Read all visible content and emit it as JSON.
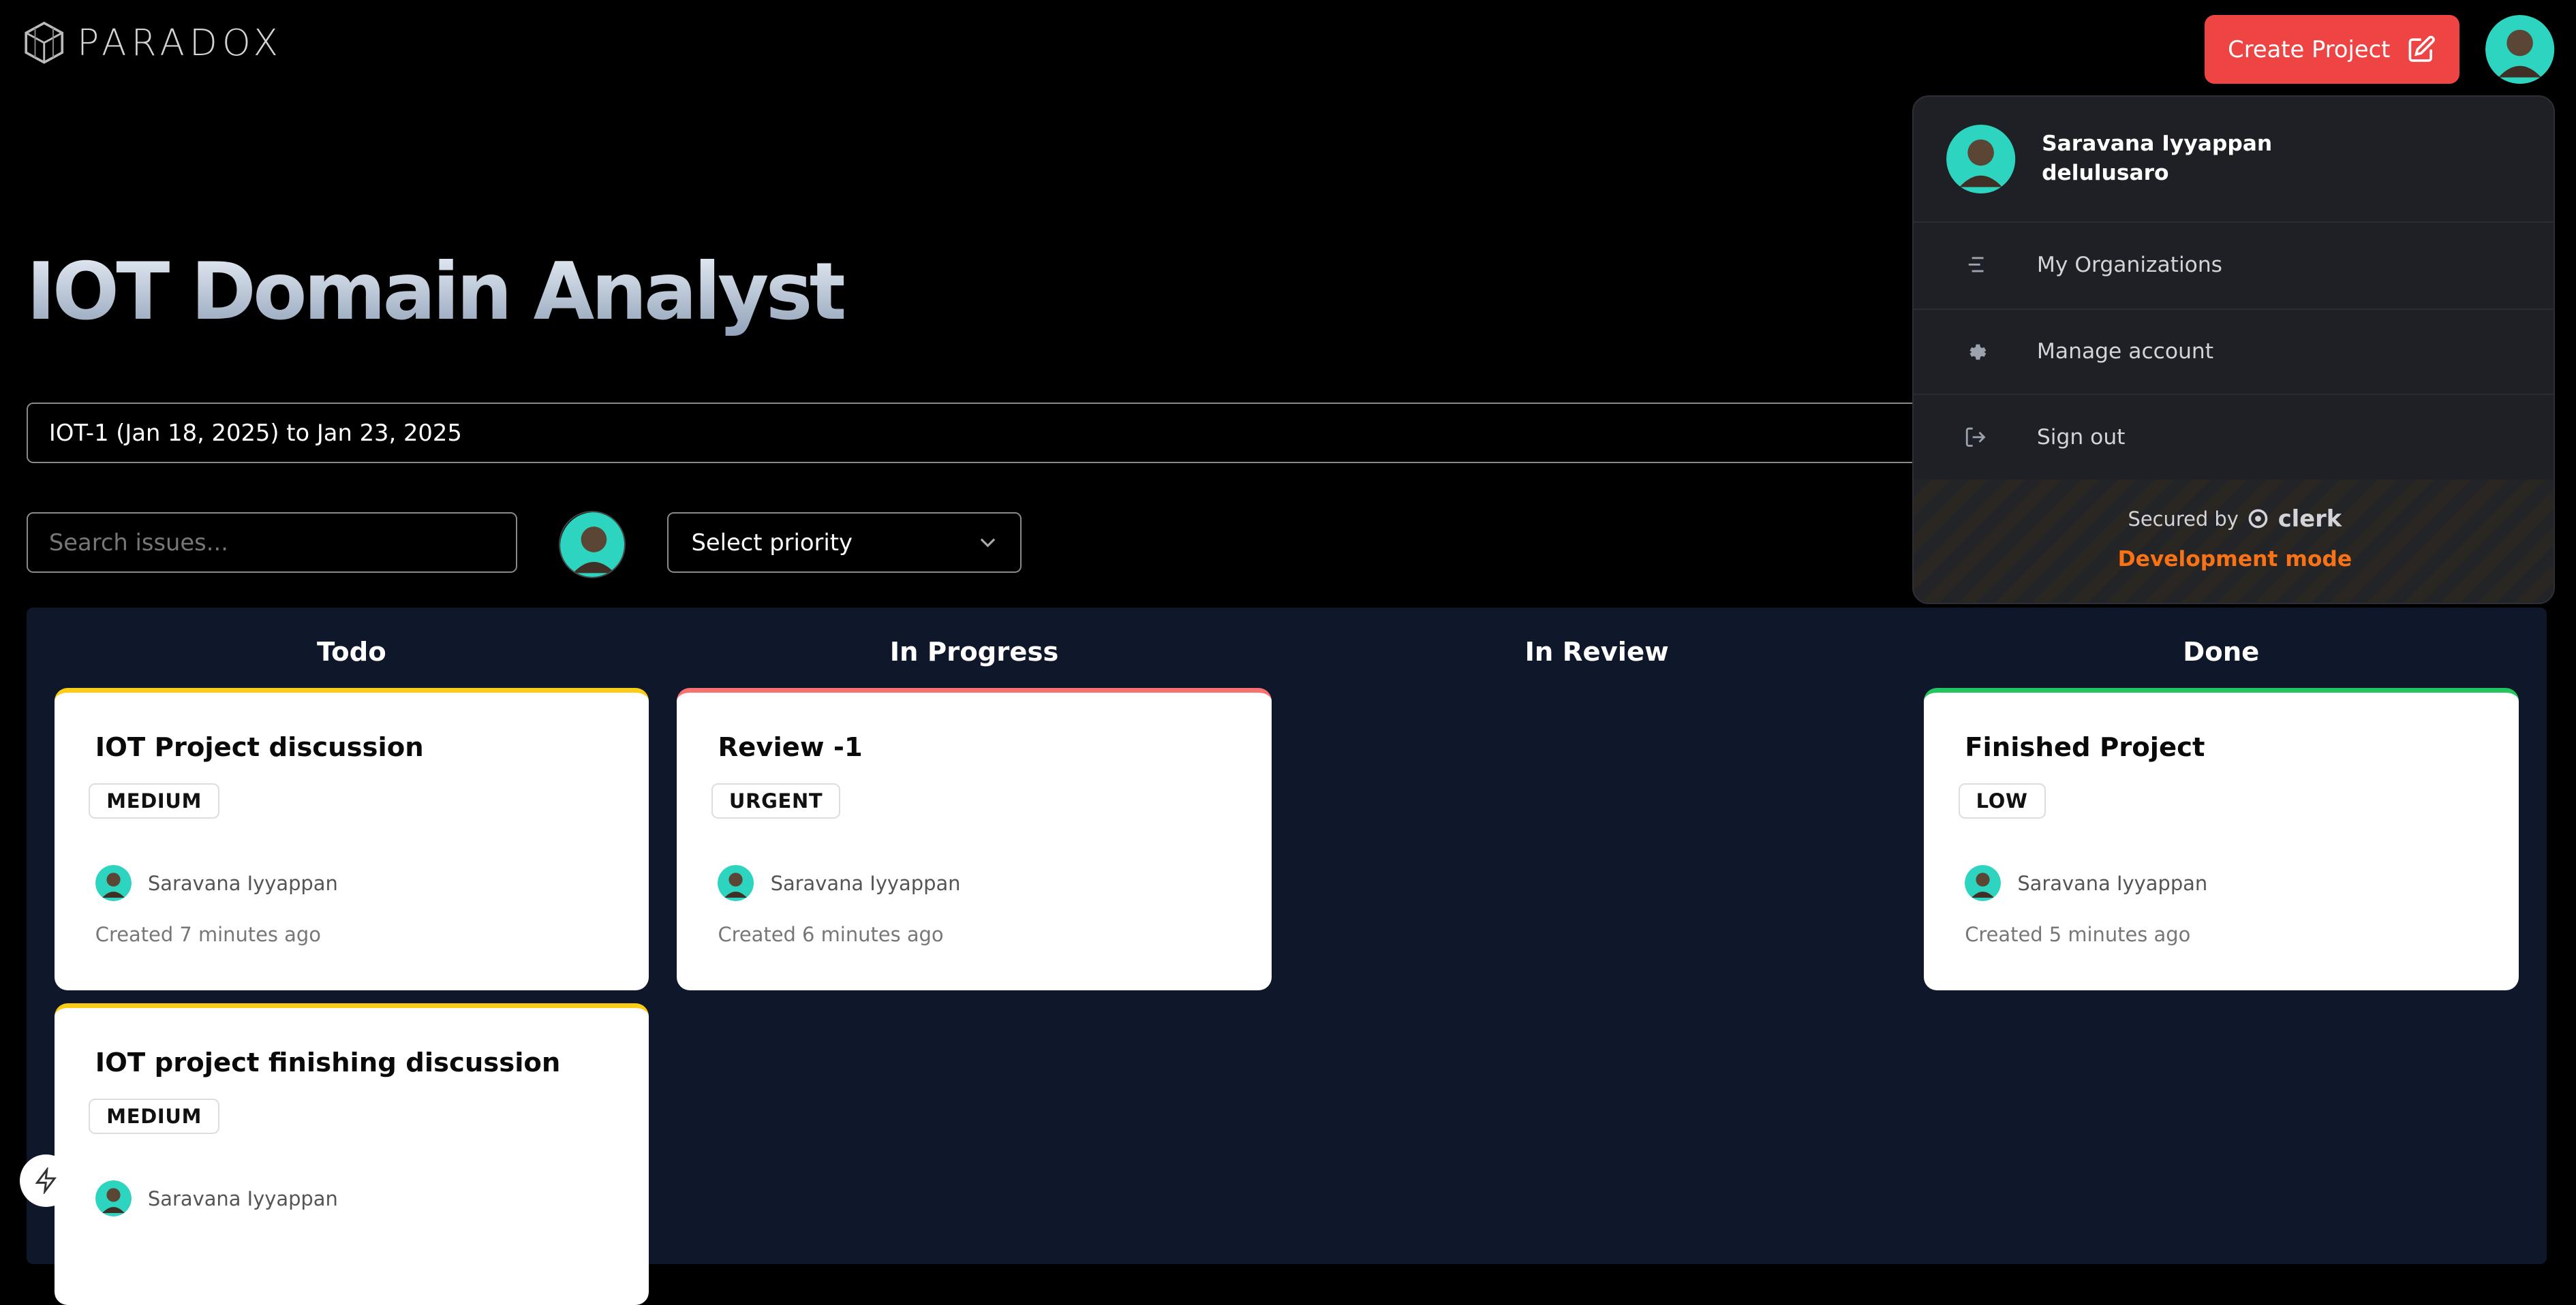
{
  "brand": {
    "name": "PARADOX"
  },
  "header": {
    "create_label": "Create Project"
  },
  "page": {
    "title": "IOT Domain Analyst"
  },
  "sprint": {
    "value": "IOT-1 (Jan 18, 2025) to Jan 23, 2025"
  },
  "filters": {
    "search_placeholder": "Search issues...",
    "priority_placeholder": "Select priority"
  },
  "board": {
    "columns": [
      "Todo",
      "In Progress",
      "In Review",
      "Done"
    ],
    "cards": [
      {
        "title": "IOT Project discussion",
        "priority": "MEDIUM",
        "assignee": "Saravana Iyyappan",
        "created": "Created 7 minutes ago"
      },
      {
        "title": "Review -1",
        "priority": "URGENT",
        "assignee": "Saravana Iyyappan",
        "created": "Created 6 minutes ago"
      },
      {
        "title": "Finished Project",
        "priority": "LOW",
        "assignee": "Saravana Iyyappan",
        "created": "Created 5 minutes ago"
      },
      {
        "title": "IOT project finishing discussion",
        "priority": "MEDIUM",
        "assignee": "Saravana Iyyappan",
        "created": ""
      }
    ]
  },
  "user_menu": {
    "name": "Saravana Iyyappan",
    "username": "delulusaro",
    "items": [
      "My Organizations",
      "Manage account",
      "Sign out"
    ],
    "secured_by": "Secured by",
    "provider": "clerk",
    "mode": "Development mode"
  },
  "colors": {
    "accent": "#ef4444",
    "medium": "#facc15",
    "urgent": "#f87171",
    "low": "#22c55e",
    "dev": "#f97316"
  }
}
